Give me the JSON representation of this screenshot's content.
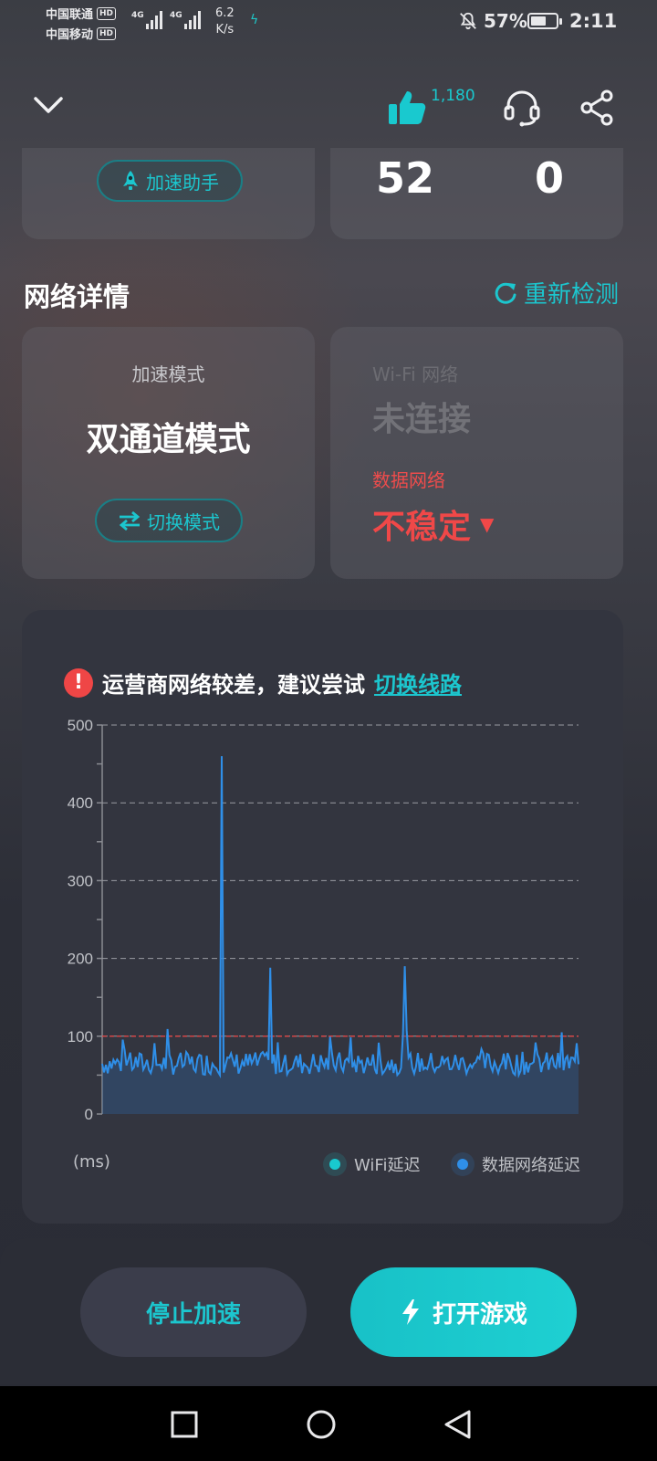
{
  "status_bar": {
    "carrier_1": "中国联通",
    "carrier_2": "中国移动",
    "hd_badge": "HD",
    "network_type": "4G",
    "net_speed_value": "6.2",
    "net_speed_unit": "K/s",
    "battery_percent": "57%",
    "time": "2:11"
  },
  "header": {
    "like_count": "1,180"
  },
  "top_cards": {
    "assist_button_label": "加速助手",
    "stat_1": "52",
    "stat_2": "0"
  },
  "network_details": {
    "title": "网络详情",
    "recheck_label": "重新检测",
    "mode_card": {
      "label": "加速模式",
      "value": "双通道模式",
      "switch_button_label": "切换模式"
    },
    "network_card": {
      "wifi_label": "Wi-Fi 网络",
      "wifi_value": "未连接",
      "data_label": "数据网络",
      "data_value": "不稳定"
    }
  },
  "warning": {
    "text": "运营商网络较差，建议尝试",
    "link_label": "切换线路"
  },
  "chart_data": {
    "type": "area",
    "ylabel": "(ms)",
    "ylim": [
      0,
      500
    ],
    "y_ticks": [
      "0",
      "100",
      "200",
      "300",
      "400",
      "500"
    ],
    "threshold": 100,
    "grid": true,
    "legend_position": "bottom-right",
    "series": [
      {
        "name": "WiFi延迟",
        "color": "#19c9cf",
        "values": []
      },
      {
        "name": "数据网络延迟",
        "color": "#2f8fe8",
        "spikes": [
          {
            "x": 64,
            "y": 460
          },
          {
            "x": 90,
            "y": 188
          },
          {
            "x": 162,
            "y": 190
          }
        ],
        "baseline_range": [
          50,
          80
        ],
        "points": 256
      }
    ]
  },
  "colors": {
    "accent": "#1cc6ce",
    "danger": "#f04848",
    "data_line": "#2f8fe8",
    "wifi_dot": "#19c9cf"
  },
  "buttons": {
    "stop_label": "停止加速",
    "open_label": "打开游戏"
  },
  "icons": {
    "collapse": "chevron-down-icon",
    "like": "thumbs-up-icon",
    "support": "headset-icon",
    "share": "share-icon",
    "assist": "rocket-icon",
    "recheck": "refresh-icon",
    "switch": "swap-arrows-icon",
    "warning": "exclamation-icon",
    "open": "lightning-icon"
  }
}
